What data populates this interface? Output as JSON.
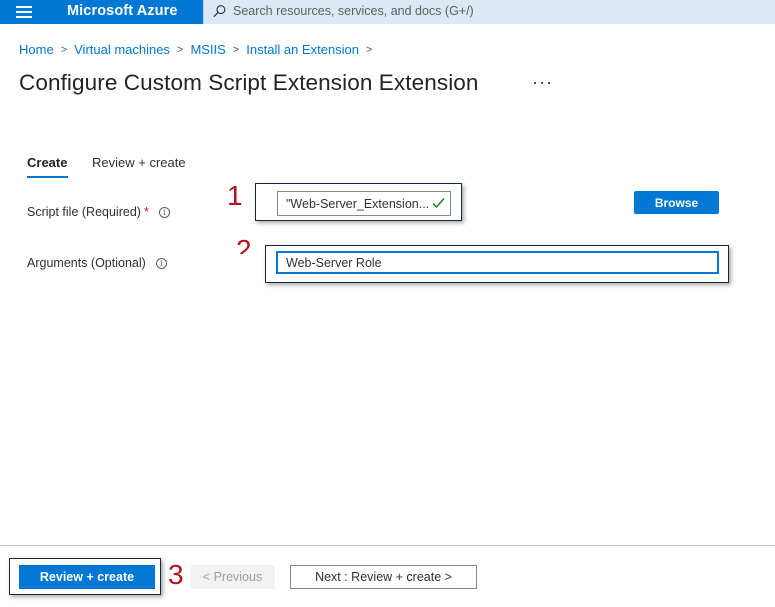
{
  "topbar": {
    "brand": "Microsoft Azure",
    "search_placeholder": "Search resources, services, and docs (G+/)",
    "icons": {
      "menu": "hamburger-icon",
      "search": "search-icon"
    }
  },
  "breadcrumb": {
    "items": [
      "Home",
      "Virtual machines",
      "MSIIS",
      "Install an Extension"
    ],
    "separator": ">"
  },
  "page": {
    "title": "Configure Custom Script Extension Extension",
    "more": "···"
  },
  "tabs": [
    {
      "label": "Create",
      "active": true
    },
    {
      "label": "Review + create",
      "active": false
    }
  ],
  "form": {
    "script_file": {
      "label": "Script file (Required)",
      "required_mark": "*",
      "value": "\"Web-Server_Extension...",
      "validated": true
    },
    "arguments": {
      "label": "Arguments (Optional)",
      "value": "Web-Server Role"
    },
    "browse_label": "Browse",
    "info_glyph": "i"
  },
  "annotations": [
    "1",
    "2",
    "3"
  ],
  "footer": {
    "review_create_label": "Review + create",
    "previous_label": "< Previous",
    "next_label": "Next : Review + create >"
  },
  "colors": {
    "accent": "#0078d4",
    "annotation": "#b3121e",
    "search_bg": "#dbe9f7",
    "success": "#107c10"
  }
}
